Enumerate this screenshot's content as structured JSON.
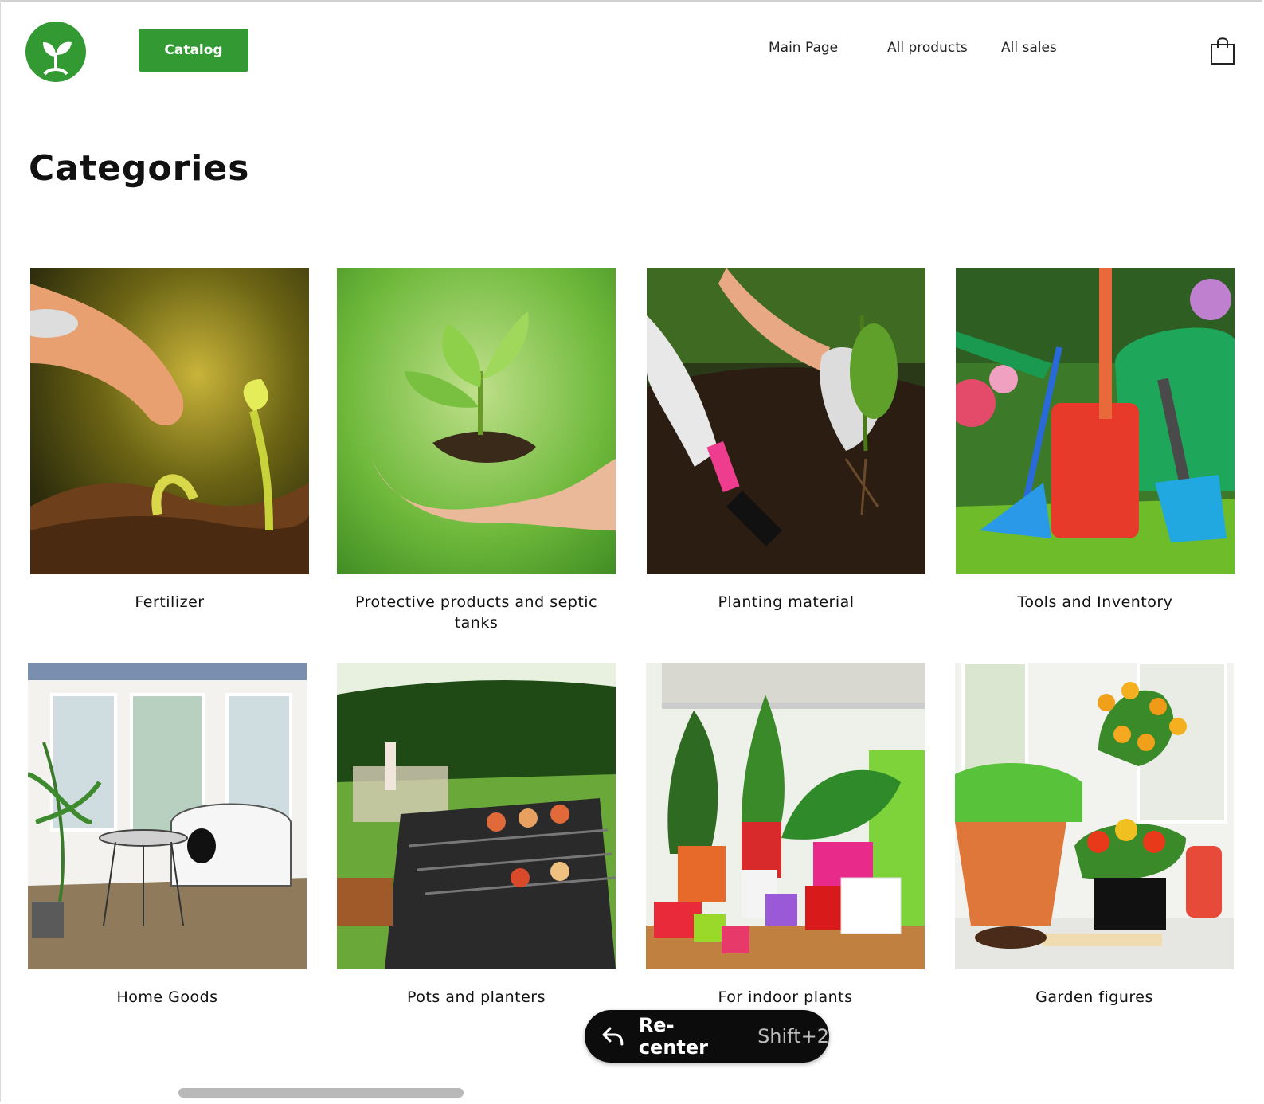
{
  "header": {
    "logo": "sprout-logo",
    "catalog_label": "Catalog",
    "nav": [
      "Main Page",
      "All products",
      "All sales"
    ],
    "cart_icon": "shopping-bag-icon"
  },
  "page_title": "Categories",
  "categories": [
    {
      "label": "Fertilizer",
      "image": "hand sowing granules over seedlings"
    },
    {
      "label": "Protective products and septic tanks",
      "image": "cupped hands holding a sprout in soil"
    },
    {
      "label": "Planting material",
      "image": "gloved hands planting a seedling"
    },
    {
      "label": "Tools and Inventory",
      "image": "garden tools and watering can on grass"
    },
    {
      "label": "Home Goods",
      "image": "bay window room with bench and plant"
    },
    {
      "label": "Pots and planters",
      "image": "barbecue grill with skewers on lawn"
    },
    {
      "label": "For indoor plants",
      "image": "colorful plant pots and houseplants"
    },
    {
      "label": "Garden figures",
      "image": "orange tree and primrose in pots"
    }
  ],
  "recenter": {
    "label": "Re-center",
    "shortcut": "Shift+2",
    "icon": "undo-arrow-icon"
  },
  "colors": {
    "brand_green": "#339933",
    "text": "#111111",
    "overlay": "#0c0c0c"
  }
}
